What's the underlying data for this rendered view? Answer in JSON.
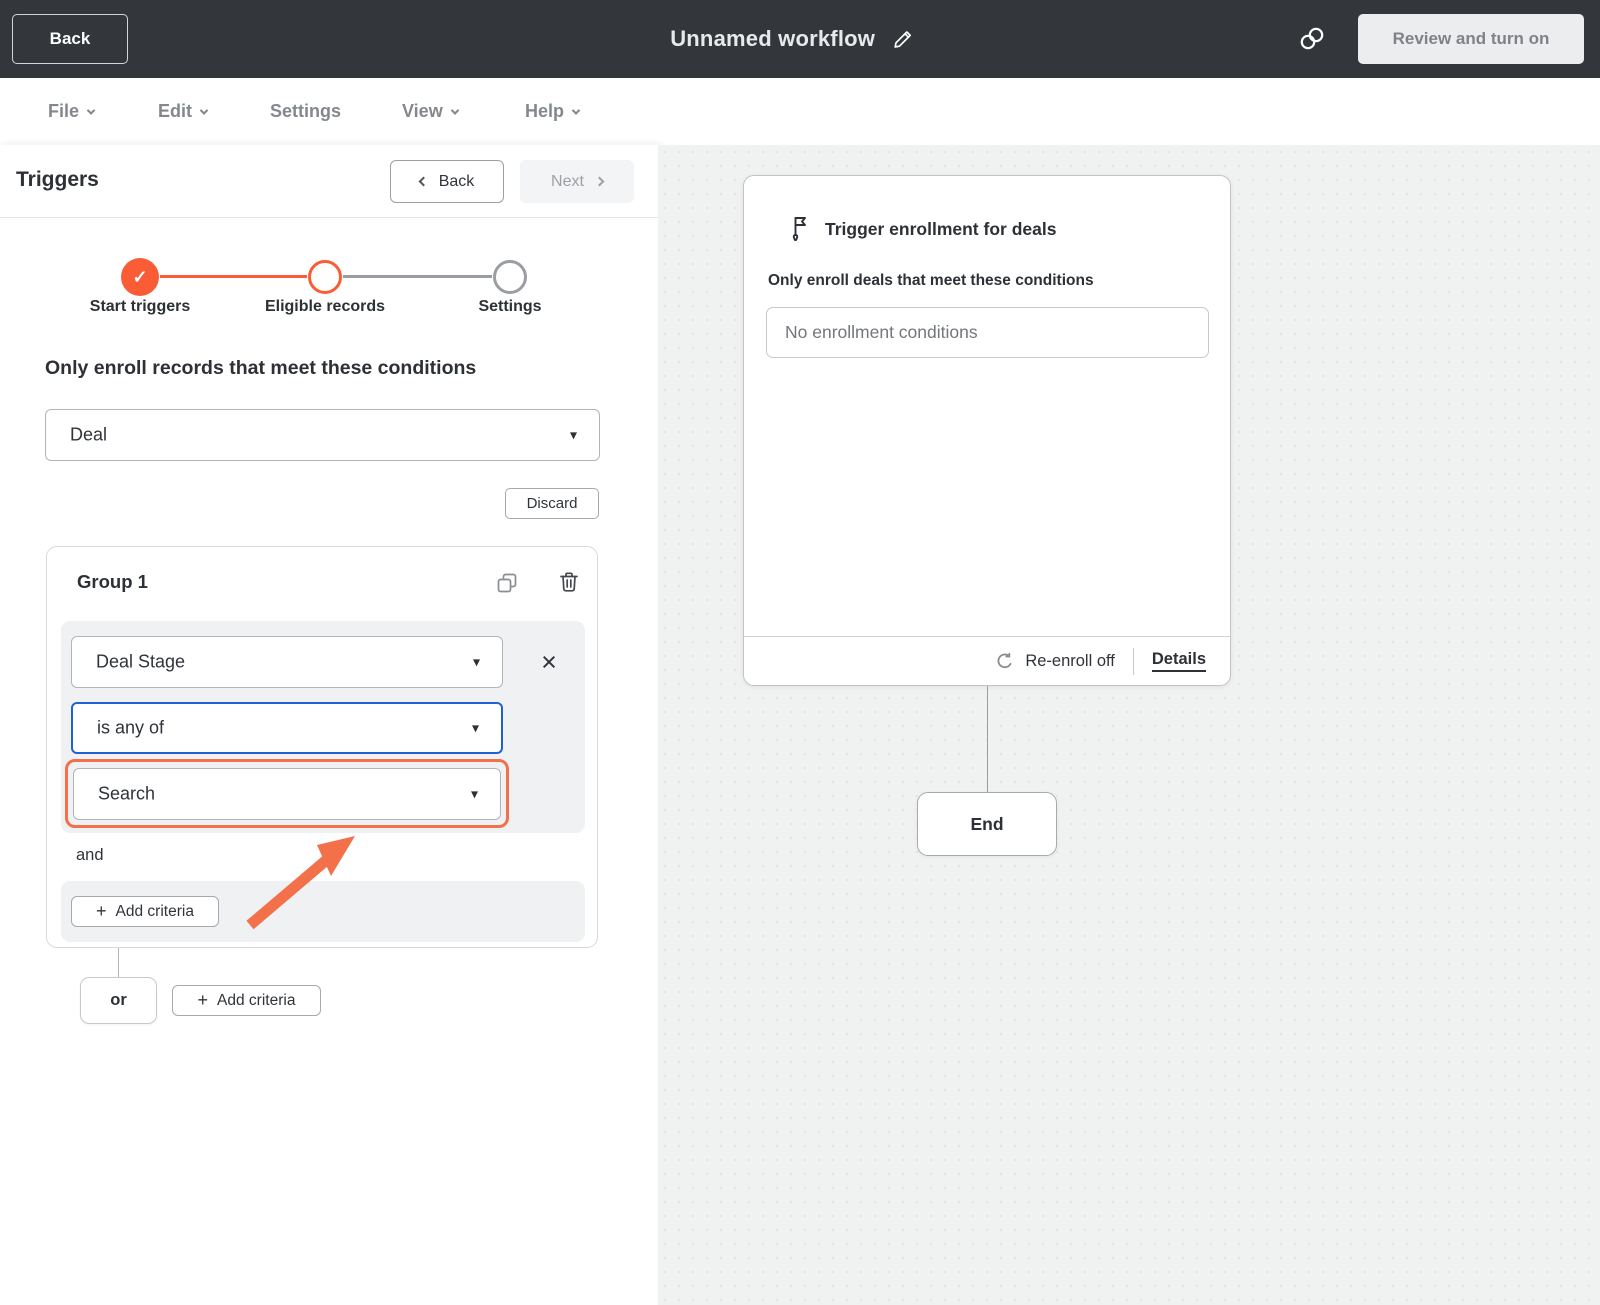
{
  "topbar": {
    "back_label": "Back",
    "title": "Unnamed workflow",
    "review_button": "Review and turn on"
  },
  "menubar": {
    "items": [
      {
        "label": "File",
        "has_chevron": true
      },
      {
        "label": "Edit",
        "has_chevron": true
      },
      {
        "label": "Settings",
        "has_chevron": false
      },
      {
        "label": "View",
        "has_chevron": true
      },
      {
        "label": "Help",
        "has_chevron": true
      }
    ]
  },
  "panel": {
    "title": "Triggers",
    "back_button": "Back",
    "next_button": "Next",
    "stepper": {
      "steps": [
        {
          "label": "Start triggers",
          "state": "complete"
        },
        {
          "label": "Eligible records",
          "state": "current"
        },
        {
          "label": "Settings",
          "state": "upcoming"
        }
      ]
    },
    "conditions_heading": "Only enroll records that meet these conditions",
    "object_select": {
      "value": "Deal"
    },
    "discard_button": "Discard",
    "group": {
      "title": "Group 1",
      "property_select": {
        "value": "Deal Stage"
      },
      "operator_select": {
        "value": "is any of"
      },
      "value_select": {
        "value": "Search"
      },
      "and_label": "and",
      "add_criteria_label": "Add criteria"
    },
    "or_label": "or",
    "or_add_criteria_label": "Add criteria"
  },
  "canvas": {
    "trigger_card": {
      "title": "Trigger enrollment for deals",
      "subtitle": "Only enroll deals that meet these conditions",
      "conditions_placeholder": "No enrollment conditions",
      "reenroll_label": "Re-enroll off",
      "details_link": "Details"
    },
    "end_node": {
      "label": "End"
    }
  },
  "icons": {
    "plus": "+",
    "caret_down": "▾",
    "close": "×",
    "check": "✓"
  },
  "colors": {
    "accent_orange": "#fa5c35",
    "annotation_orange": "#f2714a",
    "focus_blue": "#1f62d4",
    "topbar_bg": "#33373b",
    "canvas_bg": "#f0f1f1"
  }
}
